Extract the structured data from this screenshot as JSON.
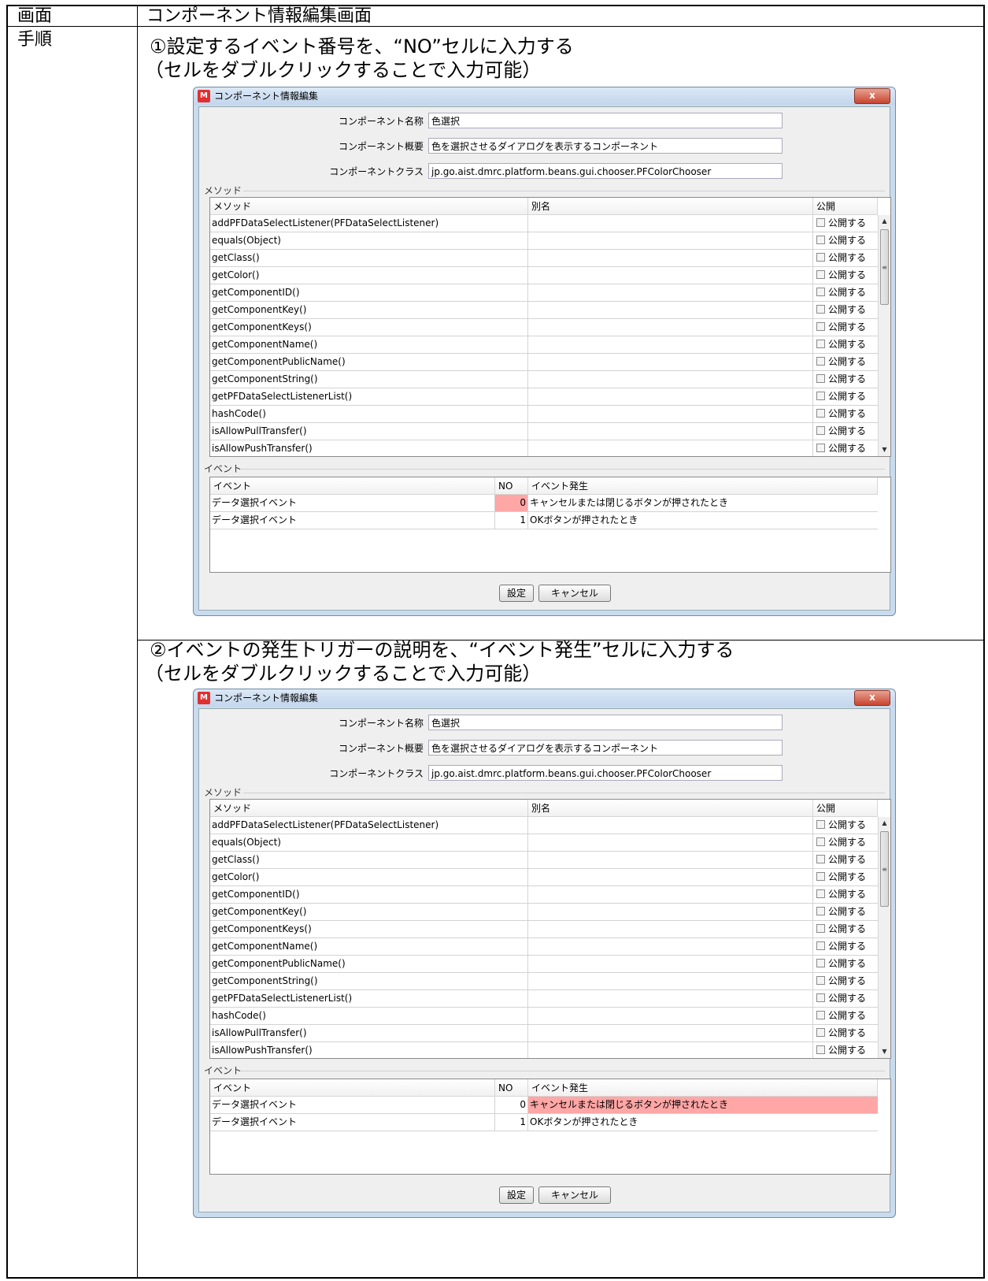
{
  "header": {
    "label_col": "画面",
    "value": "コンポーネント情報編集画面"
  },
  "procedure": {
    "label": "手順"
  },
  "steps": [
    {
      "line1": "①設定するイベント番号を、“NO”セルに入力する",
      "line2": "（セルをダブルクリックすることで入力可能）"
    },
    {
      "line1": "②イベントの発生トリガーの説明を、“イベント発生”セルに入力する",
      "line2": "（セルをダブルクリックすることで入力可能）"
    }
  ],
  "window": {
    "title": "コンポーネント情報編集",
    "icon": "app-logo-icon",
    "close_label": "x",
    "fields": [
      {
        "label": "コンポーネント名称",
        "value": "色選択"
      },
      {
        "label": "コンポーネント概要",
        "value": "色を選択させるダイアログを表示するコンポーネント"
      },
      {
        "label": "コンポーネントクラス",
        "value": "jp.go.aist.dmrc.platform.beans.gui.chooser.PFColorChooser"
      }
    ],
    "method_group_label": "メソッド",
    "method_columns": [
      "メソッド",
      "別名",
      "公開"
    ],
    "methods": [
      "addPFDataSelectListener(PFDataSelectListener)",
      "equals(Object)",
      "getClass()",
      "getColor()",
      "getComponentID()",
      "getComponentKey()",
      "getComponentKeys()",
      "getComponentName()",
      "getComponentPublicName()",
      "getComponentString()",
      "getPFDataSelectListenerList()",
      "hashCode()",
      "isAllowPullTransfer()",
      "isAllowPushTransfer()"
    ],
    "publish_label": "公開する",
    "event_group_label": "イベント",
    "event_columns": [
      "イベント",
      "NO",
      "イベント発生"
    ],
    "events": [
      {
        "name": "データ選択イベント",
        "no": "0",
        "trigger": "キャンセルまたは閉じるボタンが押されたとき"
      },
      {
        "name": "データ選択イベント",
        "no": "1",
        "trigger": "OKボタンが押されたとき"
      }
    ],
    "ok_label": "設定",
    "cancel_label": "キャンセル"
  },
  "highlight_color": "#ffa6a6"
}
